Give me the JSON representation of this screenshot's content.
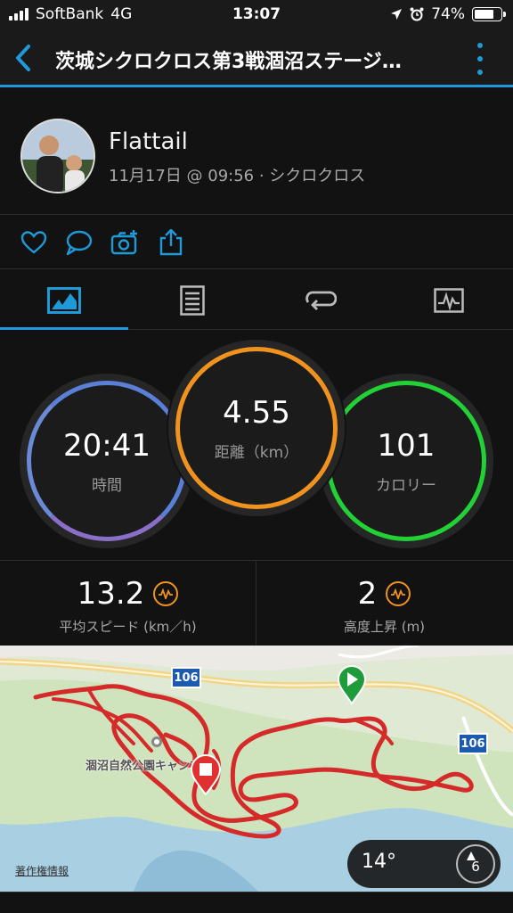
{
  "status_bar": {
    "carrier": "SoftBank",
    "network": "4G",
    "time": "13:07",
    "battery": "74%",
    "battery_level": 0.74
  },
  "nav": {
    "title": "茨城シクロクロス第3戦涸沼ステージ…"
  },
  "profile": {
    "name": "Flattail",
    "meta": "11月17日 @ 09:56 · シクロクロス"
  },
  "tabs": [
    {
      "icon": "stats-icon",
      "active": true
    },
    {
      "icon": "details-icon",
      "active": false
    },
    {
      "icon": "laps-icon",
      "active": false
    },
    {
      "icon": "charts-icon",
      "active": false
    }
  ],
  "stats": {
    "time": {
      "value": "20:41",
      "label": "時間"
    },
    "distance": {
      "value": "4.55",
      "label": "距離（km）"
    },
    "calories": {
      "value": "101",
      "label": "カロリー"
    }
  },
  "metrics": {
    "speed": {
      "value": "13.2",
      "label": "平均スピード (km／h)"
    },
    "elevation": {
      "value": "2",
      "label": "高度上昇 (m)"
    }
  },
  "map": {
    "place_label": "涸沼自然公園キャンプ場",
    "road_number_1": "106",
    "road_number_2": "106",
    "attribution": "著作権情報"
  },
  "weather": {
    "temperature": "14°",
    "wind": "6"
  },
  "colors": {
    "accent": "#1f9ad8",
    "time_ring": "#6a7fd8",
    "distance_ring": "#f0921e",
    "calories_ring": "#22d135",
    "route": "#d42a2a"
  }
}
